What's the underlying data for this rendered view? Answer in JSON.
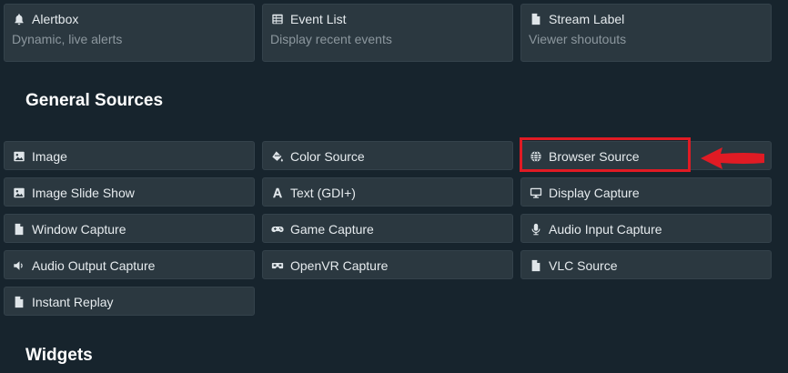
{
  "top_cards": [
    {
      "title": "Alertbox",
      "subtitle": "Dynamic, live alerts",
      "icon": "bell-icon"
    },
    {
      "title": "Event List",
      "subtitle": "Display recent events",
      "icon": "list-icon"
    },
    {
      "title": "Stream Label",
      "subtitle": "Viewer shoutouts",
      "icon": "document-icon"
    }
  ],
  "general_sources": {
    "heading": "General Sources",
    "items": [
      {
        "label": "Image",
        "icon": "image-icon"
      },
      {
        "label": "Color Source",
        "icon": "paint-bucket-icon"
      },
      {
        "label": "Browser Source",
        "icon": "globe-icon"
      },
      {
        "label": "Image Slide Show",
        "icon": "image-icon"
      },
      {
        "label": "Text (GDI+)",
        "icon": "text-icon"
      },
      {
        "label": "Display Capture",
        "icon": "monitor-icon"
      },
      {
        "label": "Window Capture",
        "icon": "document-icon"
      },
      {
        "label": "Game Capture",
        "icon": "gamepad-icon"
      },
      {
        "label": "Audio Input Capture",
        "icon": "microphone-icon"
      },
      {
        "label": "Audio Output Capture",
        "icon": "speaker-icon"
      },
      {
        "label": "OpenVR Capture",
        "icon": "vr-headset-icon"
      },
      {
        "label": "VLC Source",
        "icon": "document-icon"
      },
      {
        "label": "Instant Replay",
        "icon": "document-icon"
      }
    ]
  },
  "widgets": {
    "heading": "Widgets"
  },
  "annotation": {
    "highlight_color": "#e01b24",
    "target": "Browser Source"
  }
}
